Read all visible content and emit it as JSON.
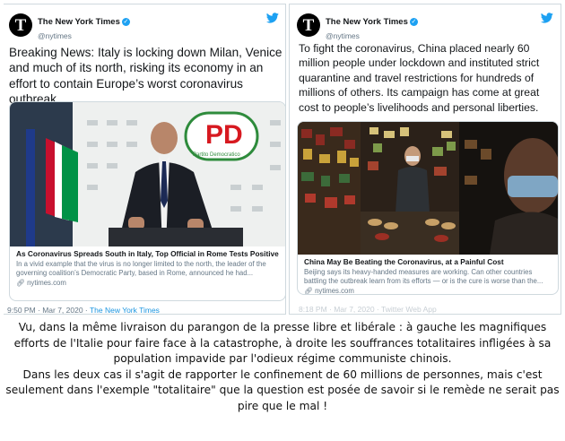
{
  "tweets": [
    {
      "account": {
        "logo_glyph": "T",
        "name": "The New York Times",
        "handle": "@nytimes"
      },
      "text": "Breaking News: Italy is locking down Milan, Venice and much of its north, risking its economy in an effort to contain Europe’s worst coronavirus outbreak.",
      "card": {
        "photo_sign_text": "PD",
        "photo_sign_subtext": "Partito Democratico",
        "title": "As Coronavirus Spreads South in Italy, Top Official in Rome Tests Positive",
        "description": "In a vivid example that the virus is no longer limited to the north, the leader of the governing coalition’s Democratic Party, based in Rome, announced he had...",
        "link": "nytimes.com"
      },
      "meta": {
        "time": "9:50 PM · Mar 7, 2020 · ",
        "source": "The New York Times"
      }
    },
    {
      "account": {
        "logo_glyph": "T",
        "name": "The New York Times",
        "handle": "@nytimes"
      },
      "text": "To fight the coronavirus, China placed nearly 60 million people under lockdown and instituted strict quarantine and travel restrictions for hundreds of millions of others. Its campaign has come at great cost to people’s livelihoods and personal liberties.",
      "card": {
        "title": "China May Be Beating the Coronavirus, at a Painful Cost",
        "description": "Beijing says its heavy-handed measures are working. Can other countries battling the outbreak learn from its efforts — or is the cure is worse than the...",
        "link": "nytimes.com"
      },
      "meta": {
        "time": "8:18 PM · Mar 7, 2020 · Twitter Web App"
      }
    }
  ],
  "caption": {
    "paragraph_1": "Vu, dans la même livraison du parangon de la presse libre et libérale : à gauche les magnifiques efforts de l'Italie pour faire face à la catastrophe, à droite les souffrances totalitaires infligées à sa population impavide par l'odieux régime communiste chinois.",
    "paragraph_2": "Dans les deux cas il s'agit de rapporter le confinement de 60 millions de personnes, mais c'est seulement dans l'exemple \"totalitaire\" que la question est posée de savoir si le remède ne serait pas pire que le mal !"
  },
  "icons": {
    "verified": "verified-badge-icon",
    "brand": "twitter-bird-icon",
    "link": "link-icon"
  },
  "colors": {
    "link_blue": "#1b95e0",
    "verified_blue": "#1da1f2",
    "muted_gray": "#657786",
    "border": "#cfd9de",
    "pd_red": "#d71920",
    "pd_green": "#2e8b3c"
  }
}
